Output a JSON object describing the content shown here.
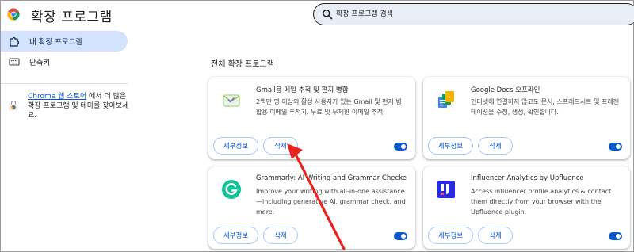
{
  "header": {
    "title": "확장 프로그램",
    "search_placeholder": "확장 프로그램 검색",
    "search_value": ""
  },
  "sidebar": {
    "items": [
      {
        "label": "내 확장 프로그램",
        "icon": "puzzle-icon",
        "active": true
      },
      {
        "label": "단축키",
        "icon": "keyboard-icon",
        "active": false
      }
    ],
    "store_promo": {
      "link": "Chrome 웹 스토어",
      "text": "에서 더 많은 확장 프로그램 및 테마를 찾아보세요."
    }
  },
  "main": {
    "section_title": "전체 확장 프로그램",
    "details_label": "세부정보",
    "remove_label": "삭제",
    "extensions": [
      {
        "name": "Gmail용 메일 추적 및 편지 병합",
        "description": "2백만 명 이상의 활성 사용자가 있는 Gmail 및 편지 병합용 이메일 추적기. 무료 및 무제한 이메일 추적.",
        "icon": "mail-tracker-icon",
        "enabled": true
      },
      {
        "name": "Google Docs 오프라인",
        "description": "인터넷에 연결하지 않고도 문서, 스프레드시트 및 프레젠테이션을 수정, 생성, 확인합니다.",
        "icon": "google-docs-icon",
        "enabled": true
      },
      {
        "name": "Grammarly: AI Writing and Grammar Checker ...",
        "description": "Improve your writing with all-in-one assistance—including generative AI, grammar check, and more.",
        "icon": "grammarly-icon",
        "enabled": true
      },
      {
        "name": "Influencer Analytics by Upfluence",
        "description": "Access influencer profile analytics & contact them directly from your browser with the Upfluence plugin.",
        "icon": "upfluence-icon",
        "enabled": true
      }
    ]
  },
  "colors": {
    "accent": "#0b57d0",
    "active_nav": "#d3e3fd",
    "search_bg": "#e9eef6",
    "annotation_arrow": "#e8231f"
  }
}
